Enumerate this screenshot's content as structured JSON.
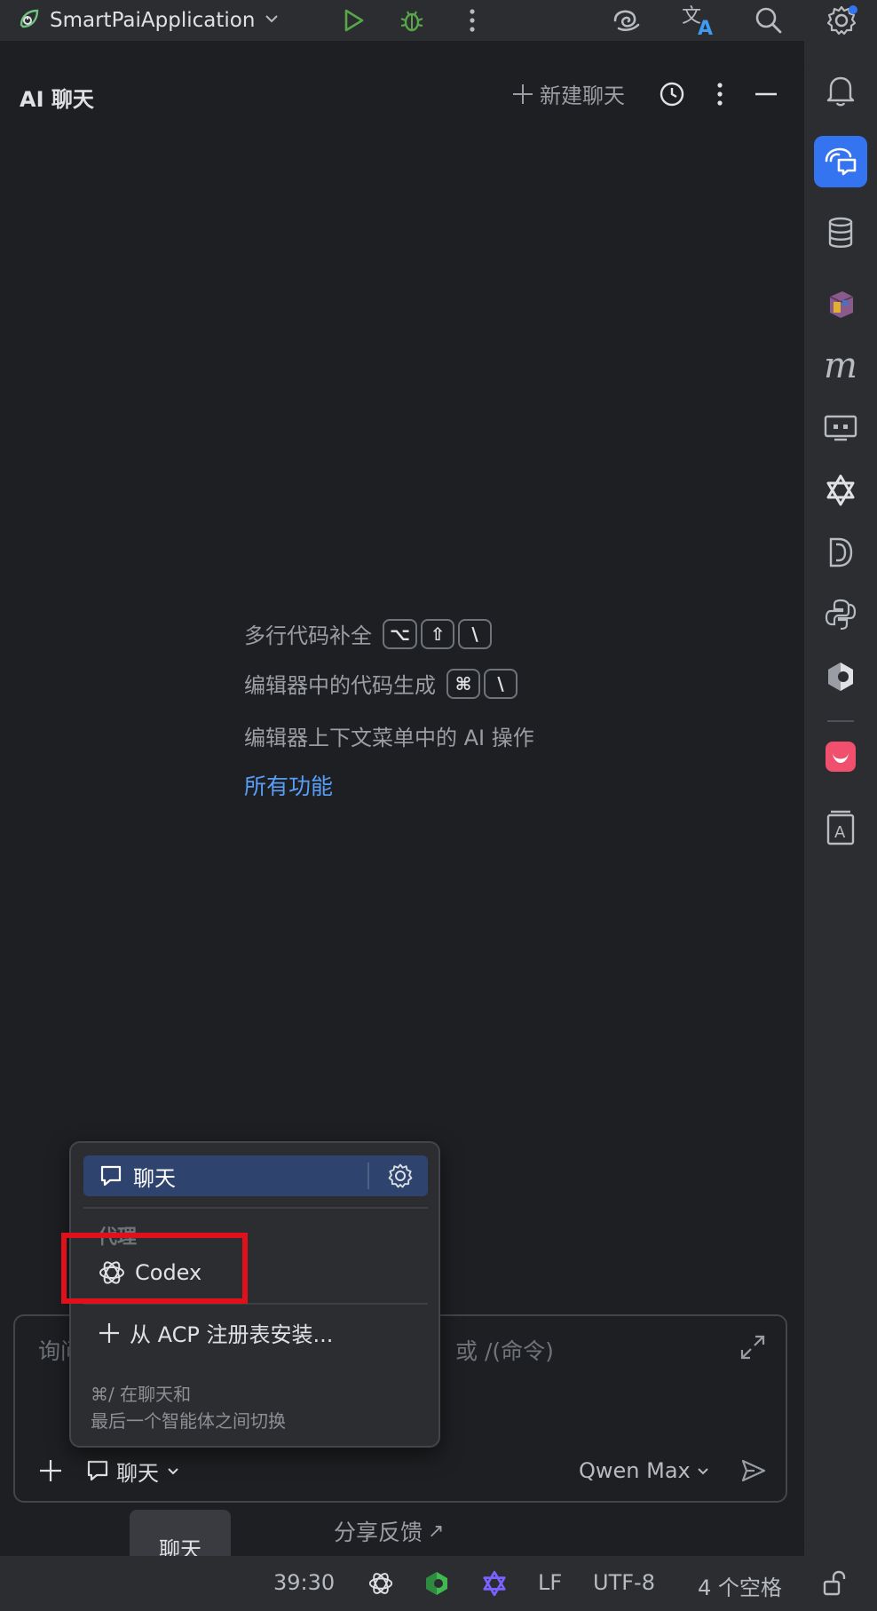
{
  "toolbar": {
    "run_config": "SmartPaiApplication"
  },
  "panel": {
    "title": "AI 聊天",
    "new_chat": "新建聊天"
  },
  "hints": [
    {
      "text": "多行代码补全",
      "keys": [
        "⌥",
        "⇧",
        "\\"
      ]
    },
    {
      "text": "编辑器中的代码生成",
      "keys": [
        "⌘",
        "\\"
      ]
    },
    {
      "text": "编辑器上下文菜单中的 AI 操作"
    }
  ],
  "all_features": "所有功能",
  "input": {
    "placeholder": "询问",
    "placeholder_tail": "或 /(命令)",
    "mode": "聊天",
    "model": "Qwen Max"
  },
  "feedback": "分享反馈",
  "feedback_arrow": "↗",
  "popup": {
    "selected": "聊天",
    "section": "代理",
    "codex": "Codex",
    "install": "从 ACP 注册表安装...",
    "footer_line1": "⌘/ 在聊天和",
    "footer_line2": "最后一个智能体之间切换"
  },
  "tooltip": "聊天",
  "statusbar": {
    "position": "39:30",
    "line_ending": "LF",
    "encoding": "UTF-8",
    "indent": "4 个空格"
  },
  "colors": {
    "accent": "#3574f0",
    "link": "#589df6",
    "highlight": "#e0111b"
  }
}
